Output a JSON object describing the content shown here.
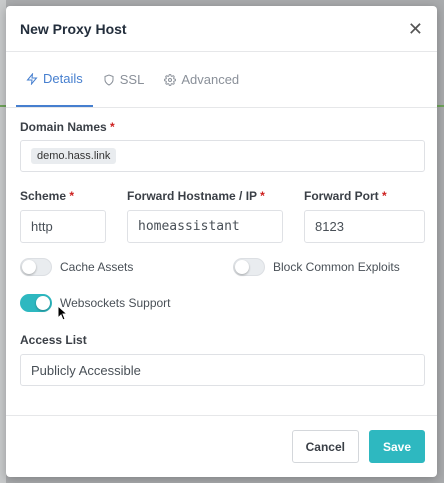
{
  "modal": {
    "title": "New Proxy Host",
    "close_glyph": "✕"
  },
  "tabs": [
    {
      "label": "Details",
      "icon": "lightning-icon",
      "active": true
    },
    {
      "label": "SSL",
      "icon": "shield-icon",
      "active": false
    },
    {
      "label": "Advanced",
      "icon": "gear-icon",
      "active": false
    }
  ],
  "form": {
    "domain_names": {
      "label": "Domain Names",
      "required": "*",
      "chips": [
        "demo.hass.link"
      ]
    },
    "scheme": {
      "label": "Scheme",
      "required": "*",
      "value": "http"
    },
    "forward_host": {
      "label": "Forward Hostname / IP",
      "required": "*",
      "value": "homeassistant"
    },
    "forward_port": {
      "label": "Forward Port",
      "required": "*",
      "value": "8123"
    },
    "cache_assets": {
      "label": "Cache Assets",
      "on": false
    },
    "block_exploits": {
      "label": "Block Common Exploits",
      "on": false
    },
    "websockets": {
      "label": "Websockets Support",
      "on": true
    },
    "access_list": {
      "label": "Access List",
      "value": "Publicly Accessible"
    }
  },
  "footer": {
    "cancel_label": "Cancel",
    "save_label": "Save"
  },
  "colors": {
    "accent_tab": "#467fcf",
    "primary": "#2eb8c0",
    "required": "#cd201f"
  }
}
